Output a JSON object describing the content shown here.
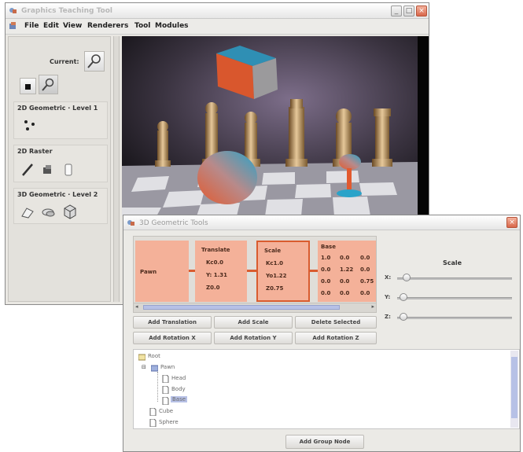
{
  "main_window": {
    "title": "Graphics Teaching Tool",
    "menu": [
      "File",
      "Edit",
      "View",
      "Renderers",
      "Tool",
      "Modules"
    ],
    "current_label": "Current:",
    "groups": {
      "g2d": "2D Geometric · Level 1",
      "raster": "2D Raster",
      "g3d": "3D Geometric · Level 2"
    },
    "icons": [
      "magnifier-icon",
      "black-square-icon",
      "magnifier-small-icon",
      "dots-icon",
      "brush-icon",
      "fill-icon",
      "eraser-icon",
      "tool-3d-a-icon",
      "tool-3d-b-icon",
      "cube-icon"
    ]
  },
  "dialog": {
    "title": "3D Geometric Tools",
    "nodes": {
      "pawn": "Pawn",
      "translate": {
        "title": "Translate",
        "lines": [
          "Kc0.0",
          "Y: 1.31",
          "Z0.0"
        ]
      },
      "scale": {
        "title": "Scale",
        "lines": [
          "Kc1.0",
          "Yo1.22",
          "Z0.75"
        ]
      },
      "base": {
        "title": "Base",
        "rows": [
          [
            "1.0",
            "0.0",
            "0.0"
          ],
          [
            "0.0",
            "1.22",
            "0.0"
          ],
          [
            "0.0",
            "0.0",
            "0.75"
          ],
          [
            "0.0",
            "0.0",
            "0.0"
          ]
        ]
      }
    },
    "scale_panel": {
      "title": "Scale",
      "axes": [
        "X:",
        "Y:",
        "Z:"
      ],
      "levels": [
        0.05,
        0.02,
        0.02
      ]
    },
    "buttons": {
      "add_translation": "Add Translation",
      "add_scale": "Add Scale",
      "delete_selected": "Delete Selected",
      "add_rotation_x": "Add Rotation X",
      "add_rotation_y": "Add Rotation Y",
      "add_rotation_z": "Add Rotation Z",
      "add_group_node": "Add Group Node"
    },
    "tree": {
      "root": "Root",
      "pawn": "Pawn",
      "head": "Head",
      "body": "Body",
      "base": "Base",
      "cube": "Cube",
      "sphere": "Sphere"
    }
  },
  "colors": {
    "accent": "#d95c2f",
    "node_fill": "#f4b199",
    "selection": "#b7c1e6"
  }
}
